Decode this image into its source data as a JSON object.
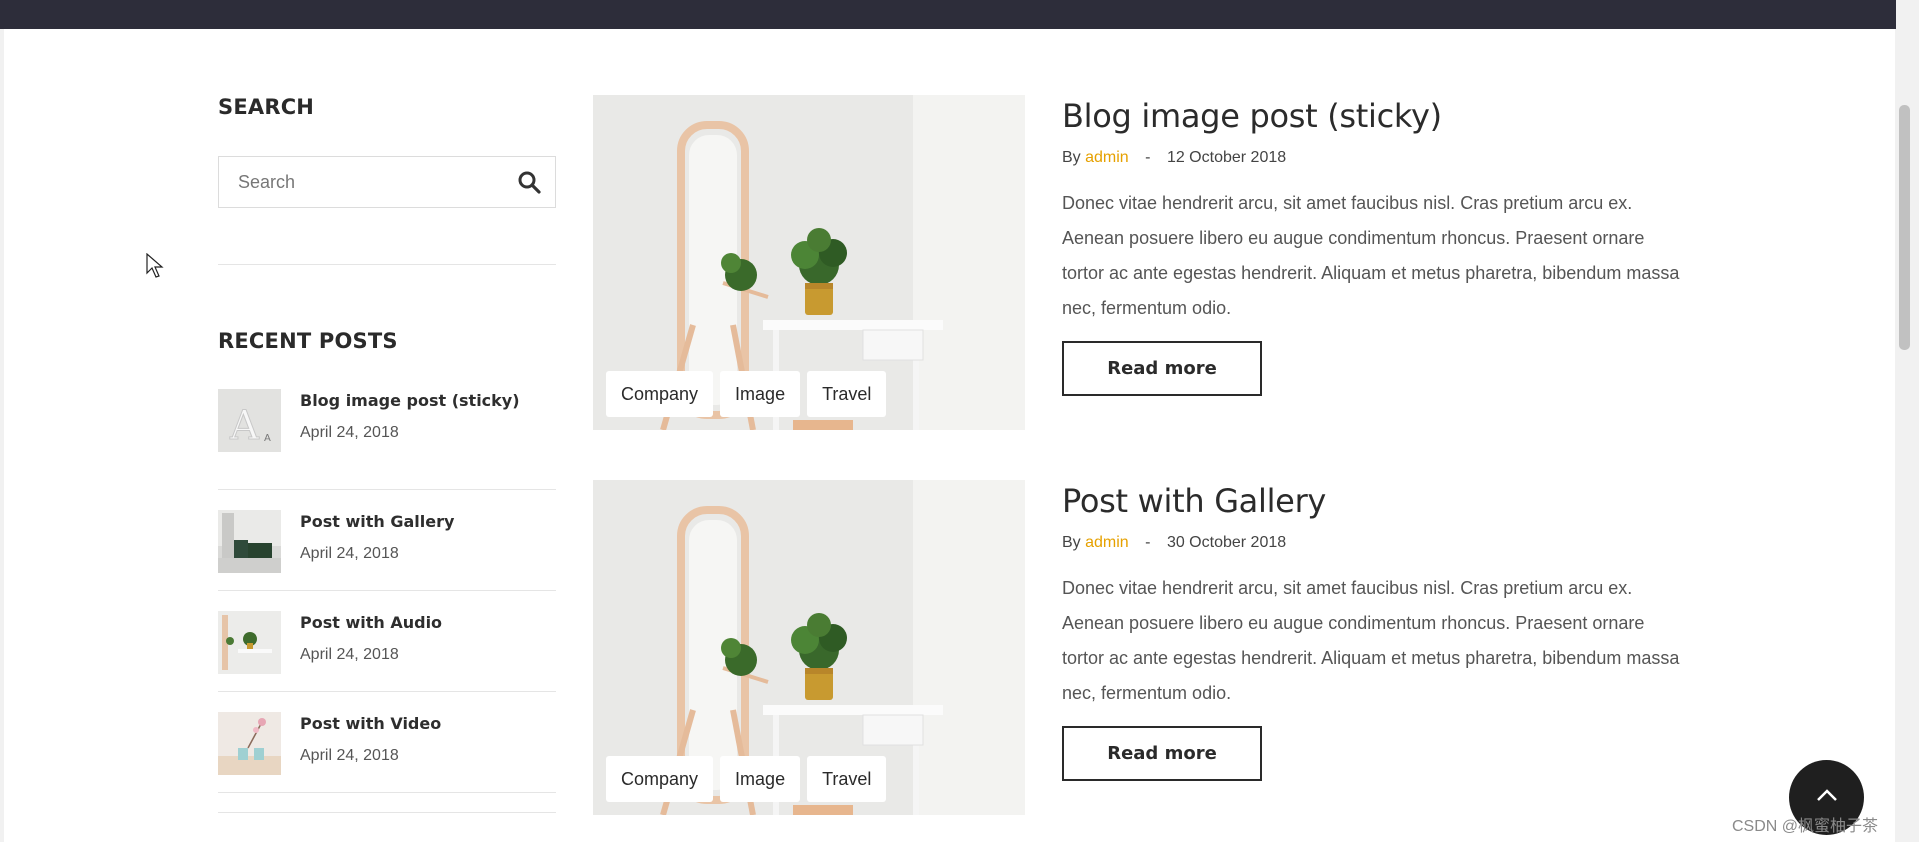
{
  "sidebar": {
    "search_title": "SEARCH",
    "search_placeholder": "Search",
    "recent_title": "RECENT POSTS",
    "recent_posts": [
      {
        "title": "Blog image post (sticky)",
        "date": "April 24, 2018"
      },
      {
        "title": "Post with Gallery",
        "date": "April 24, 2018"
      },
      {
        "title": "Post with Audio",
        "date": "April 24, 2018"
      },
      {
        "title": "Post with Video",
        "date": "April 24, 2018"
      }
    ]
  },
  "posts": [
    {
      "title": "Blog image post (sticky)",
      "by": "By",
      "author": "admin",
      "separator": "-",
      "date": "12 October 2018",
      "excerpt": "Donec vitae hendrerit arcu, sit amet faucibus nisl. Cras pretium arcu ex. Aenean posuere libero eu augue condimentum rhoncus. Praesent ornare tortor ac ante egestas hendrerit. Aliquam et metus pharetra, bibendum massa nec, fermentum odio.",
      "tags": [
        "Company",
        "Image",
        "Travel"
      ],
      "read_more": "Read more"
    },
    {
      "title": "Post with Gallery",
      "by": "By",
      "author": "admin",
      "separator": "-",
      "date": "30 October 2018",
      "excerpt": "Donec vitae hendrerit arcu, sit amet faucibus nisl. Cras pretium arcu ex. Aenean posuere libero eu augue condimentum rhoncus. Praesent ornare tortor ac ante egestas hendrerit. Aliquam et metus pharetra, bibendum massa nec, fermentum odio.",
      "tags": [
        "Company",
        "Image",
        "Travel"
      ],
      "read_more": "Read more"
    }
  ],
  "watermark": "CSDN @枫蜜柚子茶",
  "colors": {
    "accent": "#e6a100",
    "topbar": "#2d2d3a",
    "dark": "#2a2a2a"
  },
  "icons": {
    "search": "search-icon",
    "scroll_top": "chevron-up-icon"
  }
}
